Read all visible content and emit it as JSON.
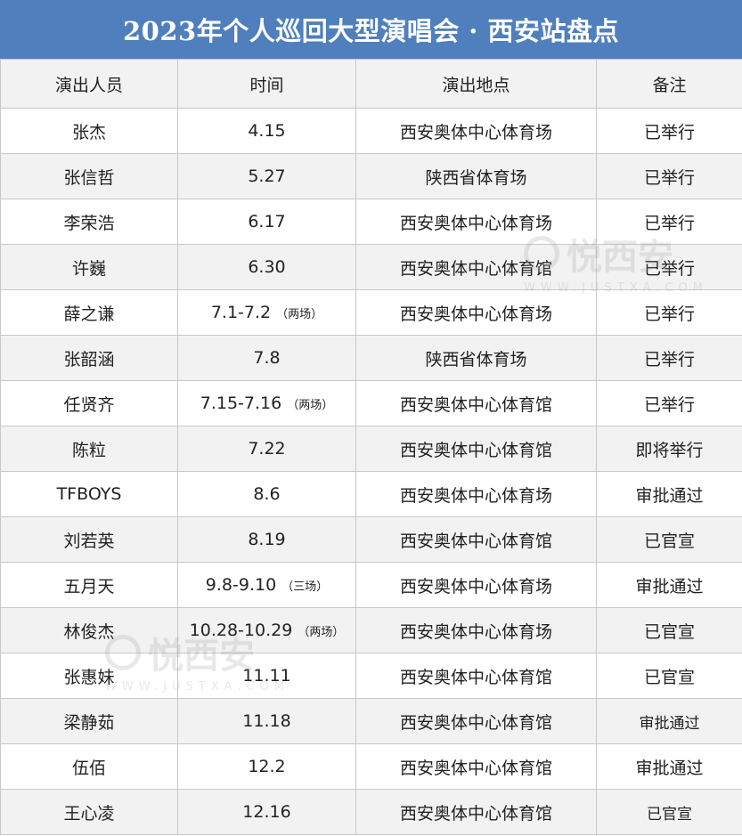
{
  "title": "2023年个人巡回大型演唱会 · 西安站盘点",
  "columns": [
    "演出人员",
    "时间",
    "演出地点",
    "备注"
  ],
  "rows": [
    {
      "artist": "张杰",
      "date": "4.15",
      "note": "",
      "venue": "西安奥体中心体育场",
      "status": "已举行"
    },
    {
      "artist": "张信哲",
      "date": "5.27",
      "note": "",
      "venue": "陕西省体育场",
      "status": "已举行"
    },
    {
      "artist": "李荣浩",
      "date": "6.17",
      "note": "",
      "venue": "西安奥体中心体育场",
      "status": "已举行"
    },
    {
      "artist": "许巍",
      "date": "6.30",
      "note": "",
      "venue": "西安奥体中心体育馆",
      "status": "已举行"
    },
    {
      "artist": "薛之谦",
      "date": "7.1-7.2",
      "note": "（两场）",
      "venue": "西安奥体中心体育场",
      "status": "已举行"
    },
    {
      "artist": "张韶涵",
      "date": "7.8",
      "note": "",
      "venue": "陕西省体育场",
      "status": "已举行"
    },
    {
      "artist": "任贤齐",
      "date": "7.15-7.16",
      "note": "（两场）",
      "venue": "西安奥体中心体育馆",
      "status": "已举行"
    },
    {
      "artist": "陈粒",
      "date": "7.22",
      "note": "",
      "venue": "西安奥体中心体育馆",
      "status": "即将举行"
    },
    {
      "artist": "TFBOYS",
      "date": "8.6",
      "note": "",
      "venue": "西安奥体中心体育场",
      "status": "审批通过"
    },
    {
      "artist": "刘若英",
      "date": "8.19",
      "note": "",
      "venue": "西安奥体中心体育馆",
      "status": "已官宣"
    },
    {
      "artist": "五月天",
      "date": "9.8-9.10",
      "note": "（三场）",
      "venue": "西安奥体中心体育场",
      "status": "审批通过"
    },
    {
      "artist": "林俊杰",
      "date": "10.28-10.29",
      "note": "（两场）",
      "venue": "西安奥体中心体育场",
      "status": "已官宣"
    },
    {
      "artist": "张惠妹",
      "date": "11.11",
      "note": "",
      "venue": "西安奥体中心体育馆",
      "status": "已官宣"
    },
    {
      "artist": "梁静茹",
      "date": "11.18",
      "note": "",
      "venue": "西安奥体中心体育馆",
      "status": "审批通过"
    },
    {
      "artist": "伍佰",
      "date": "12.2",
      "note": "",
      "venue": "西安奥体中心体育馆",
      "status": "审批通过"
    },
    {
      "artist": "王心凌",
      "date": "12.16",
      "note": "",
      "venue": "西安奥体中心体育馆",
      "status": "已官宣"
    }
  ],
  "watermark": {
    "text": "悦西安",
    "url": "WWW.JUSTXA.COM"
  },
  "colors": {
    "header_bar": "#4f7fbd",
    "stripe": "#f2f2f2",
    "border": "#c8c8c8"
  }
}
